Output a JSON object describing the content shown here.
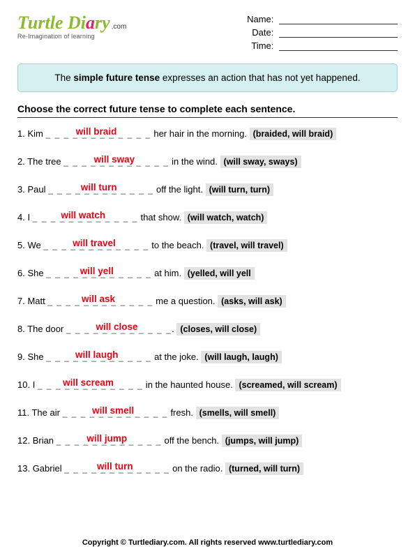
{
  "logo": {
    "text": "Turtle Diary",
    "dotcom": ".com",
    "sub": "Re-Imagination of learning"
  },
  "meta": {
    "name_label": "Name:",
    "date_label": "Date:",
    "time_label": "Time:"
  },
  "infobox": {
    "pre": "The ",
    "bold": "simple future tense",
    "post": " expresses an action that has not yet happened."
  },
  "directions": "Choose the correct future tense to complete each sentence.",
  "items": [
    {
      "n": "1.",
      "pre": "Kim ",
      "ans": "will braid",
      "post": " her hair in the morning.",
      "choices": "(braided, will braid)"
    },
    {
      "n": "2.",
      "pre": "The tree ",
      "ans": "will sway",
      "post": " in the wind.",
      "choices": "(will sway, sways)"
    },
    {
      "n": "3.",
      "pre": "Paul ",
      "ans": "will turn",
      "post": " off the light.",
      "choices": "(will turn, turn)"
    },
    {
      "n": "4.",
      "pre": "I ",
      "ans": "will watch",
      "post": " that show.",
      "choices": "(will watch, watch)"
    },
    {
      "n": "5.",
      "pre": "We ",
      "ans": "will travel",
      "post": " to the beach.",
      "choices": "(travel, will travel)"
    },
    {
      "n": "6.",
      "pre": "She ",
      "ans": "will yell",
      "post": " at him.",
      "choices": "(yelled, will yell"
    },
    {
      "n": "7.",
      "pre": "Matt ",
      "ans": "will ask",
      "post": " me a question.",
      "choices": "(asks, will ask)"
    },
    {
      "n": "8.",
      "pre": "The door ",
      "ans": "will close",
      "post": ".",
      "choices": "(closes, will close)"
    },
    {
      "n": "9.",
      "pre": "She ",
      "ans": "will laugh",
      "post": " at the joke.",
      "choices": "(will laugh, laugh)"
    },
    {
      "n": "10.",
      "pre": "I ",
      "ans": "will scream",
      "post": " in the haunted house.",
      "choices": "(screamed, will scream)"
    },
    {
      "n": "11.",
      "pre": "The air ",
      "ans": "will smell",
      "post": " fresh.",
      "choices": "(smells, will smell)"
    },
    {
      "n": "12.",
      "pre": "Brian ",
      "ans": "will jump",
      "post": " off the bench.",
      "choices": "(jumps, will jump)"
    },
    {
      "n": "13.",
      "pre": "Gabriel ",
      "ans": "will turn",
      "post": " on the radio.",
      "choices": "(turned, will turn)"
    }
  ],
  "blank_pattern": "_ _ _ _ _ _ _ _ _ _ _ _",
  "footer": "Copyright © Turtlediary.com. All rights reserved   www.turtlediary.com"
}
